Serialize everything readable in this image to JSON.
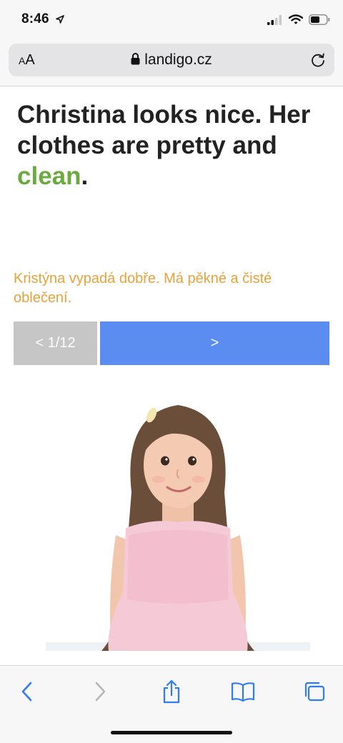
{
  "status_bar": {
    "time": "8:46",
    "icons": [
      "location-arrow-icon",
      "cellular-signal-icon",
      "wifi-icon",
      "battery-icon"
    ]
  },
  "browser": {
    "text_size_label_small": "A",
    "text_size_label_large": "A",
    "url": "landigo.cz",
    "icons": [
      "lock-icon",
      "reload-icon"
    ],
    "toolbar_icons": [
      "back-icon",
      "forward-icon",
      "share-icon",
      "bookmarks-icon",
      "tabs-icon"
    ]
  },
  "lesson": {
    "sentence_part1": "Christina looks nice. Her clothes are pretty and ",
    "highlight_word": "clean",
    "sentence_end": ".",
    "translation": "Kristýna vypadá dobře. Má pěkné a čisté oblečení.",
    "prev_label": "< 1/12",
    "next_label": ">",
    "image_subject": "girl in pink dress"
  },
  "colors": {
    "highlight": "#6aaa3e",
    "translation": "#e8a23a",
    "next_button": "#5a8def",
    "prev_button": "#c6c6c6",
    "ios_blue": "#2f7cf6"
  }
}
